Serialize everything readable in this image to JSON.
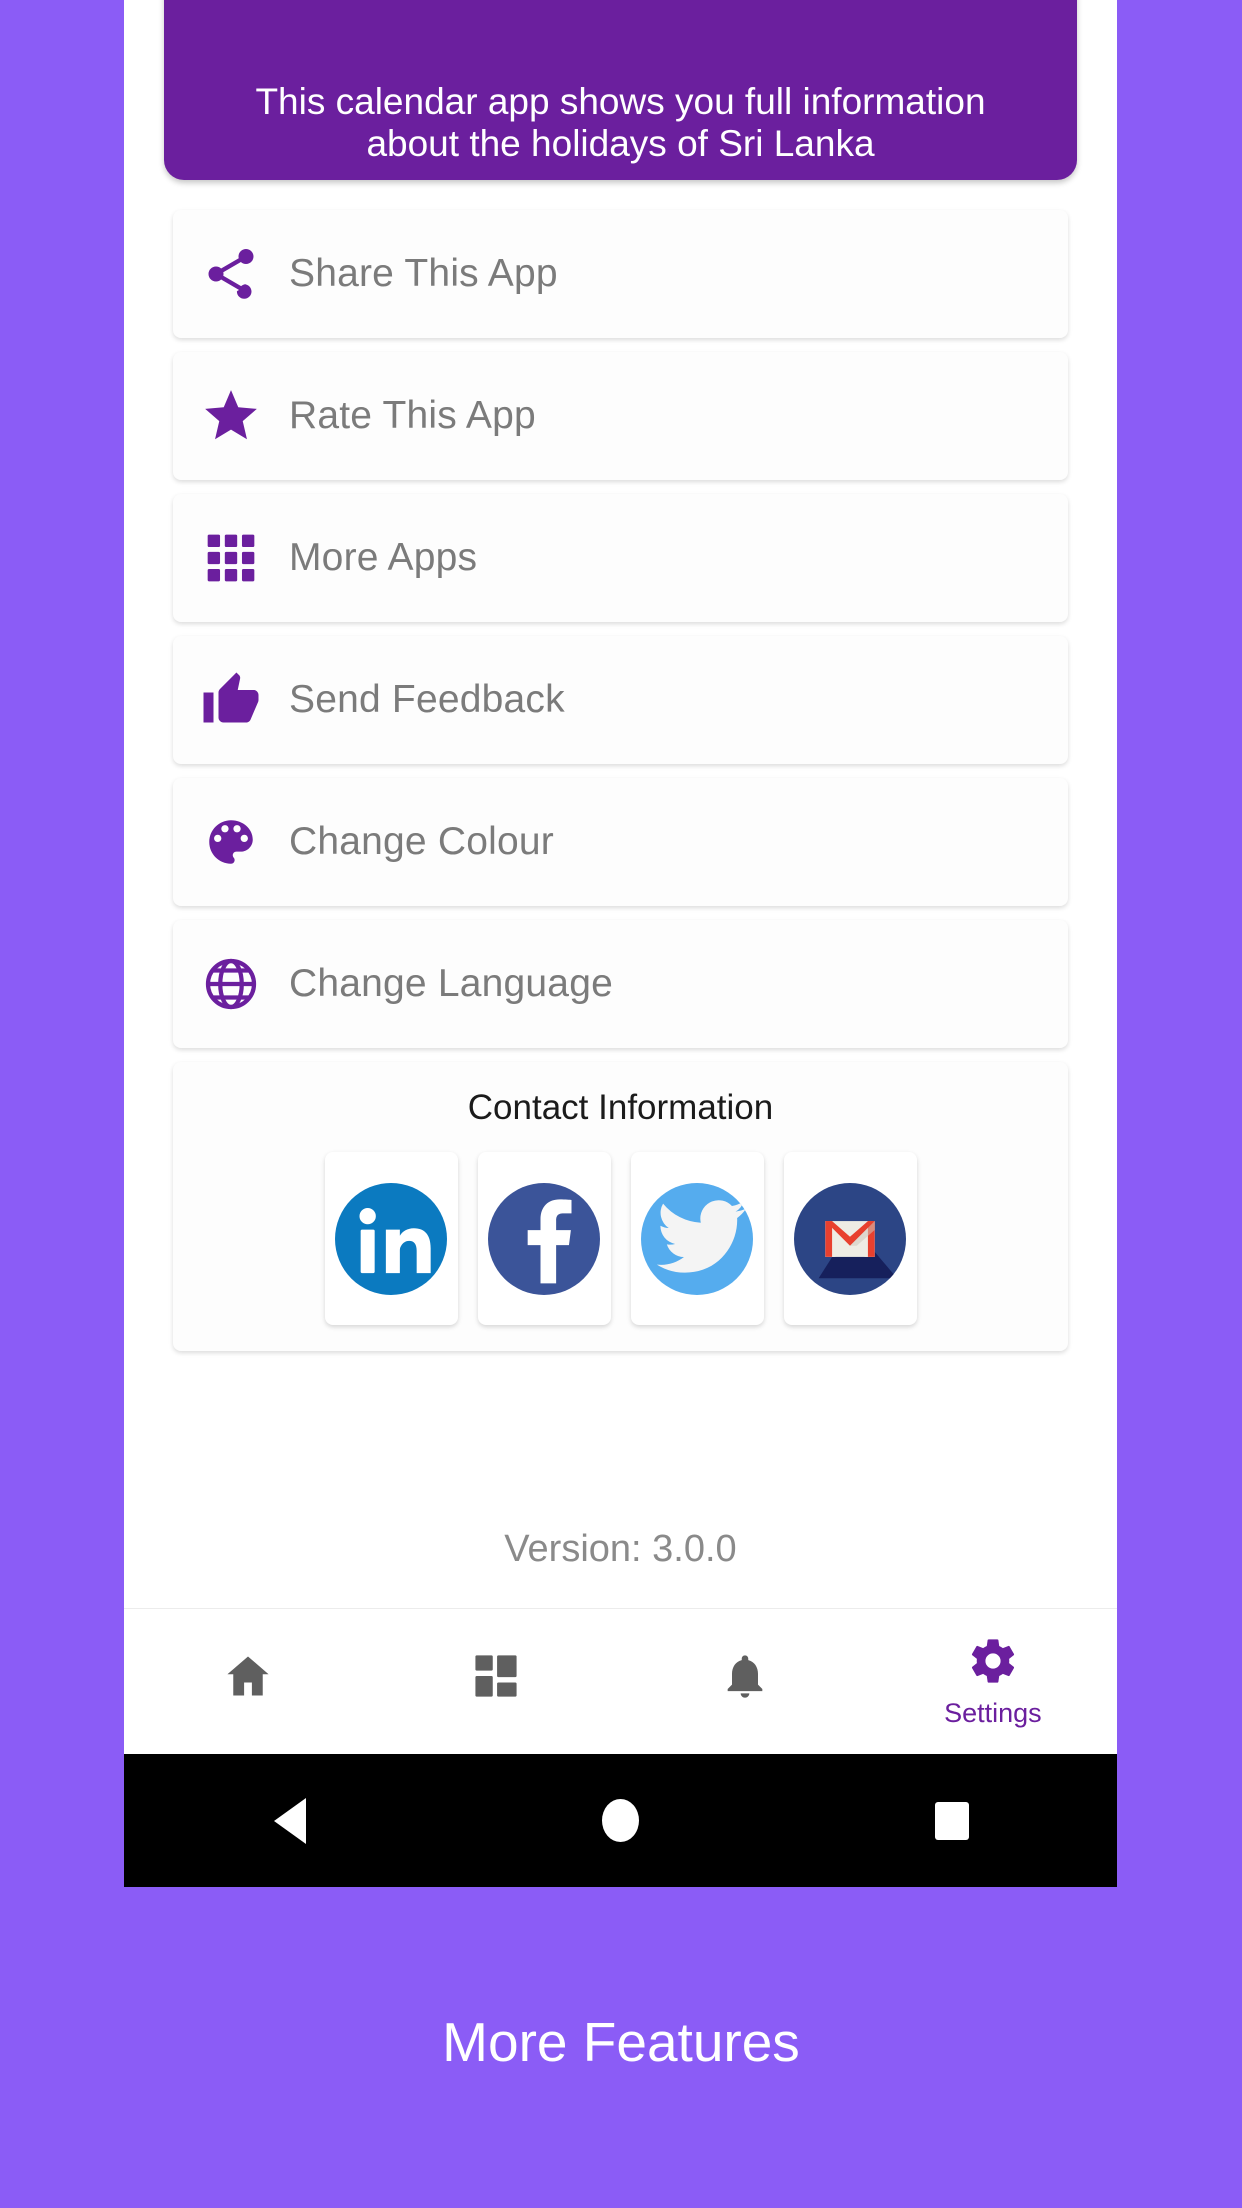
{
  "theme": {
    "page_bg": "#8b5cf6",
    "banner_bg": "#6b1f9e",
    "accent": "#6b1f9e",
    "card_bg": "#fdfdfd",
    "label_color": "#7b7b7b"
  },
  "banner": {
    "text": "This calendar app shows you full information about the holidays of Sri Lanka"
  },
  "menu": {
    "items": [
      {
        "label": "Share This App",
        "icon": "share-icon"
      },
      {
        "label": "Rate This App",
        "icon": "star-icon"
      },
      {
        "label": "More Apps",
        "icon": "apps-grid-icon"
      },
      {
        "label": "Send Feedback",
        "icon": "thumbs-up-icon"
      },
      {
        "label": "Change Colour",
        "icon": "palette-icon"
      },
      {
        "label": "Change Language",
        "icon": "globe-icon"
      }
    ]
  },
  "contact": {
    "title": "Contact Information",
    "socials": [
      {
        "name": "linkedin",
        "icon": "linkedin-icon",
        "color": "#0b7ac0"
      },
      {
        "name": "facebook",
        "icon": "facebook-icon",
        "color": "#3b5499"
      },
      {
        "name": "twitter",
        "icon": "twitter-icon",
        "color": "#55acee"
      },
      {
        "name": "gmail",
        "icon": "gmail-icon",
        "color": "#2c4585"
      }
    ]
  },
  "version": {
    "text": "Version: 3.0.0"
  },
  "bottom_nav": {
    "items": [
      {
        "label": "",
        "icon": "home-icon",
        "active": false
      },
      {
        "label": "",
        "icon": "dashboard-icon",
        "active": false
      },
      {
        "label": "",
        "icon": "bell-icon",
        "active": false
      },
      {
        "label": "Settings",
        "icon": "gear-icon",
        "active": true
      }
    ]
  },
  "system_bar": {
    "back": "back-triangle-icon",
    "home": "home-circle-icon",
    "recents": "recents-square-icon"
  },
  "caption": {
    "text": "More Features"
  }
}
